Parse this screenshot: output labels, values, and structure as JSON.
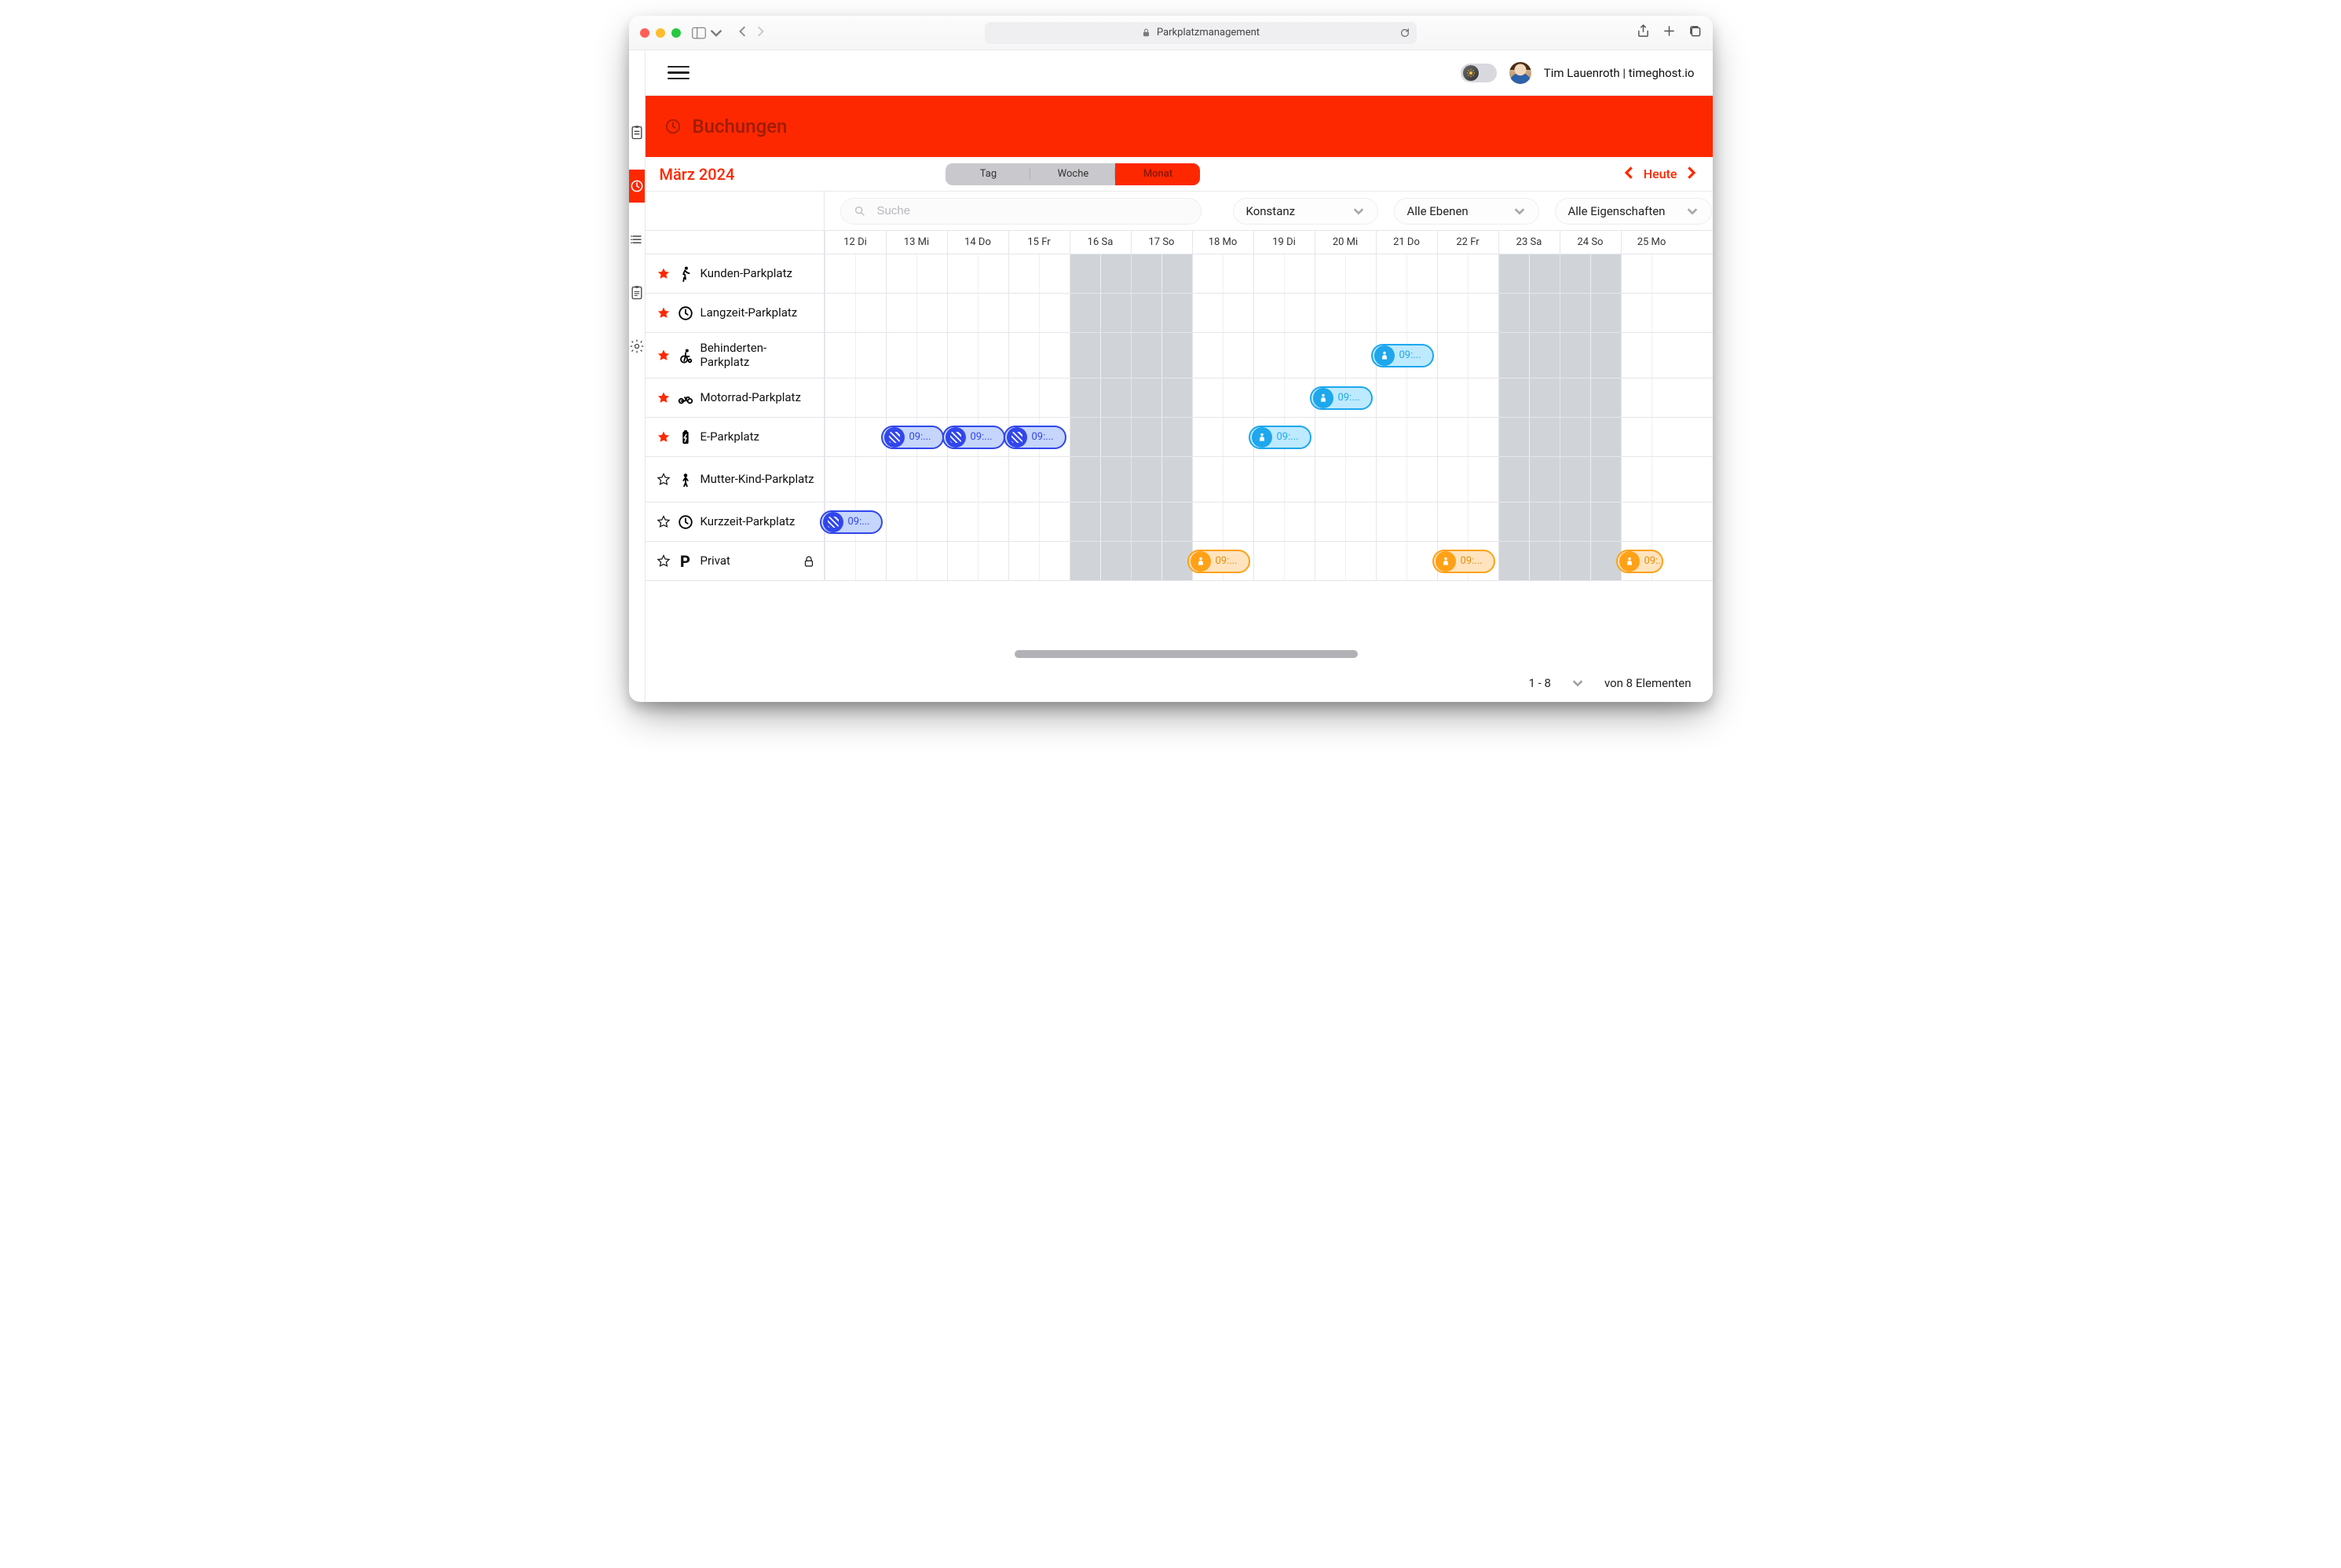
{
  "browser": {
    "address": "Parkplatzmanagement"
  },
  "user_label": "Tim Lauenroth | timeghost.io",
  "page_title": "Buchungen",
  "month_label": "März 2024",
  "view_tabs": {
    "day": "Tag",
    "week": "Woche",
    "month": "Monat",
    "active": "month"
  },
  "today_label": "Heute",
  "filters": {
    "search_placeholder": "Suche",
    "location": "Konstanz",
    "level": "Alle Ebenen",
    "props": "Alle Eigenschaften"
  },
  "days": [
    {
      "n": "12",
      "w": "Di"
    },
    {
      "n": "13",
      "w": "Mi"
    },
    {
      "n": "14",
      "w": "Do"
    },
    {
      "n": "15",
      "w": "Fr"
    },
    {
      "n": "16",
      "w": "Sa",
      "wk": true
    },
    {
      "n": "17",
      "w": "So",
      "wk": true
    },
    {
      "n": "18",
      "w": "Mo"
    },
    {
      "n": "19",
      "w": "Di"
    },
    {
      "n": "20",
      "w": "Mi"
    },
    {
      "n": "21",
      "w": "Do"
    },
    {
      "n": "22",
      "w": "Fr"
    },
    {
      "n": "23",
      "w": "Sa",
      "wk": true
    },
    {
      "n": "24",
      "w": "So",
      "wk": true
    },
    {
      "n": "25",
      "w": "Mo"
    }
  ],
  "rows": [
    {
      "id": "kunden",
      "label": "Kunden-Parkplatz",
      "fav": true,
      "icon": "walk",
      "tall": false
    },
    {
      "id": "langzeit",
      "label": "Langzeit-Parkplatz",
      "fav": true,
      "icon": "clock",
      "tall": false
    },
    {
      "id": "behind",
      "label": "Behinderten-Parkplatz",
      "fav": true,
      "icon": "wheel",
      "tall": true
    },
    {
      "id": "moto",
      "label": "Motorrad-Parkplatz",
      "fav": true,
      "icon": "moto",
      "tall": false
    },
    {
      "id": "epark",
      "label": "E-Parkplatz",
      "fav": true,
      "icon": "battery",
      "tall": false
    },
    {
      "id": "mutter",
      "label": "Mutter-Kind-Parkplatz",
      "fav": false,
      "icon": "person",
      "tall": true
    },
    {
      "id": "kurz",
      "label": "Kurzzeit-Parkplatz",
      "fav": false,
      "icon": "clock",
      "tall": false
    },
    {
      "id": "privat",
      "label": "Privat",
      "fav": false,
      "icon": "P",
      "tall": false,
      "locked": true
    }
  ],
  "bookings": [
    {
      "row": "behind",
      "day": 21,
      "color": "teal",
      "kind": "person",
      "text": "09:..."
    },
    {
      "row": "moto",
      "day": 20,
      "color": "teal",
      "kind": "person",
      "text": "09:..."
    },
    {
      "row": "epark",
      "day": 13,
      "color": "blue",
      "kind": "stripes",
      "text": "09:..."
    },
    {
      "row": "epark",
      "day": 14,
      "color": "blue",
      "kind": "stripes",
      "text": "09:..."
    },
    {
      "row": "epark",
      "day": 15,
      "color": "blue",
      "kind": "stripes",
      "text": "09:..."
    },
    {
      "row": "epark",
      "day": 19,
      "color": "teal",
      "kind": "person",
      "text": "09:..."
    },
    {
      "row": "kurz",
      "day": 12,
      "color": "blue",
      "kind": "stripes",
      "text": "09:..."
    },
    {
      "row": "privat",
      "day": 18,
      "color": "orange",
      "kind": "person",
      "text": "09:..."
    },
    {
      "row": "privat",
      "day": 22,
      "color": "orange",
      "kind": "person",
      "text": "09:..."
    },
    {
      "row": "privat",
      "day": 25,
      "color": "orange",
      "kind": "person",
      "text": "09:...",
      "edge": true
    }
  ],
  "pager": {
    "range": "1 - 8",
    "of": "von 8 Elementen"
  }
}
